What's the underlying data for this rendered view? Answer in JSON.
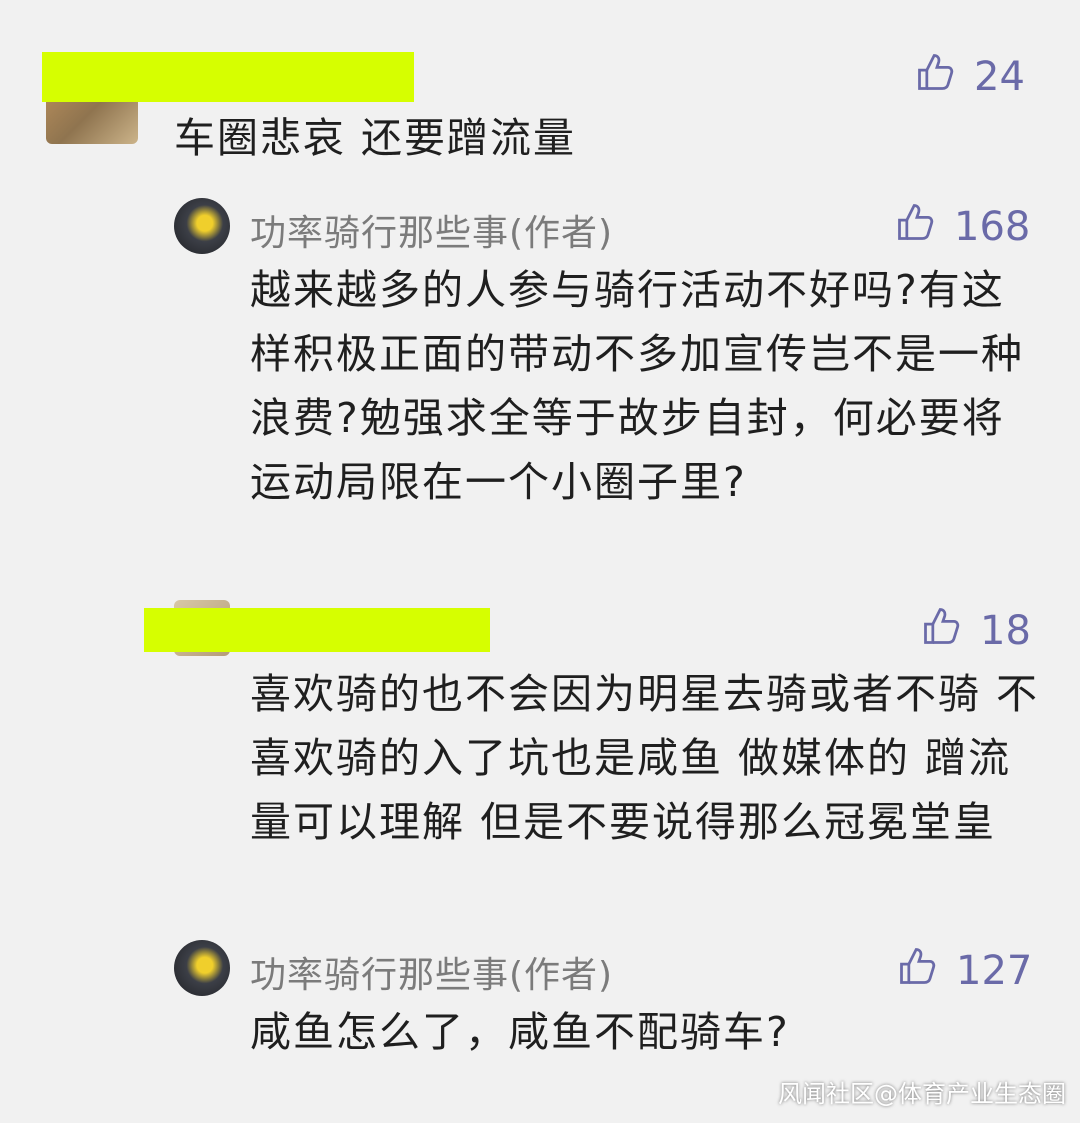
{
  "comments": [
    {
      "name": "",
      "likes": "24",
      "text": "车圈悲哀 还要蹭流量"
    },
    {
      "name": "功率骑行那些事(作者)",
      "likes": "168",
      "text": "越来越多的人参与骑行活动不好吗?有这样积极正面的带动不多加宣传岂不是一种浪费?勉强求全等于故步自封，何必要将运动局限在一个小圈子里?"
    },
    {
      "name": "",
      "likes": "18",
      "text": "喜欢骑的也不会因为明星去骑或者不骑 不喜欢骑的入了坑也是咸鱼 做媒体的 蹭流量可以理解 但是不要说得那么冠冕堂皇"
    },
    {
      "name": "功率骑行那些事(作者)",
      "likes": "127",
      "text": "咸鱼怎么了，咸鱼不配骑车?"
    }
  ],
  "watermark": "风闻社区@体育产业生态圈",
  "icons": {
    "like": "thumbs-up-icon",
    "avatar": "avatar-image"
  },
  "colors": {
    "redaction": "#d6ff00",
    "like": "#6a6aa8",
    "name": "#7b7b7b",
    "background": "#f1f1f1"
  }
}
